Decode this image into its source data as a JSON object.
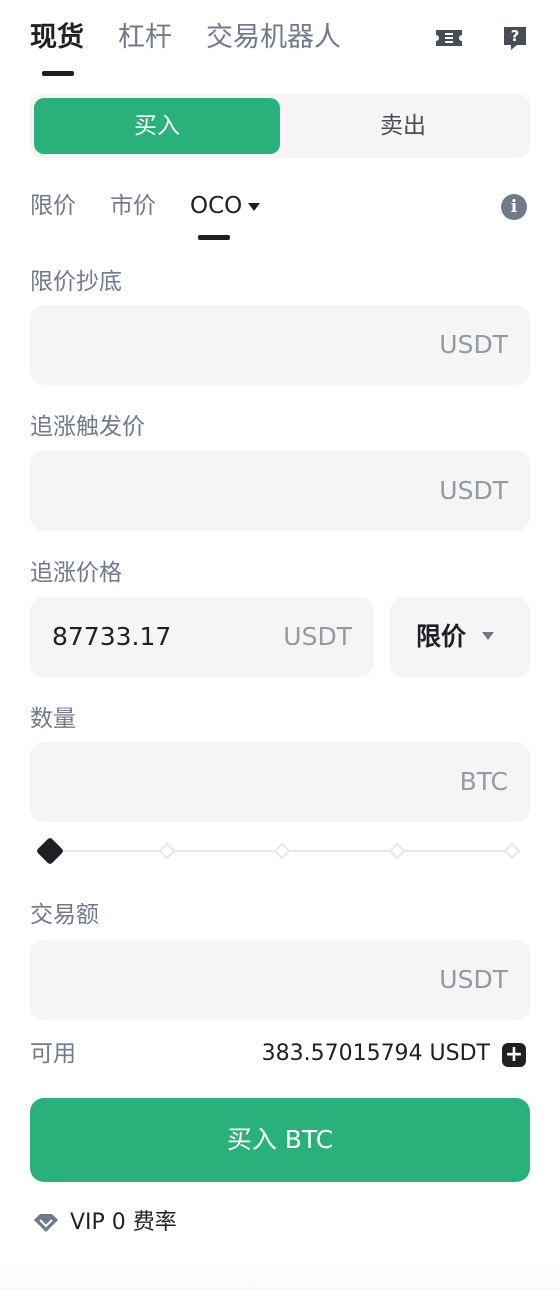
{
  "header": {
    "tabs": [
      {
        "label": "现货"
      },
      {
        "label": "杠杆"
      },
      {
        "label": "交易机器人"
      }
    ],
    "icons": [
      "ticket-icon",
      "help-icon"
    ]
  },
  "side": {
    "buy_label": "买入",
    "sell_label": "卖出"
  },
  "order_types": [
    {
      "label": "限价"
    },
    {
      "label": "市价"
    },
    {
      "label": "OCO"
    }
  ],
  "form": {
    "limit_buy": {
      "label": "限价抄底",
      "unit": "USDT",
      "value": ""
    },
    "stop_trigger": {
      "label": "追涨触发价",
      "unit": "USDT",
      "value": ""
    },
    "stop_price": {
      "label": "追涨价格",
      "unit": "USDT",
      "value": "87733.17",
      "type": "限价"
    },
    "quantity": {
      "label": "数量",
      "unit": "BTC",
      "value": ""
    },
    "slider": {
      "steps": 5,
      "value": 0
    },
    "total": {
      "label": "交易额",
      "unit": "USDT",
      "value": ""
    }
  },
  "available": {
    "label": "可用",
    "value": "383.57015794 USDT"
  },
  "submit_label": "买入 BTC",
  "vip_label": "VIP 0 费率",
  "colors": {
    "accent": "#2ab07a",
    "text": "#1e2026",
    "muted": "#707a8a",
    "field_bg": "#f5f5f5"
  }
}
